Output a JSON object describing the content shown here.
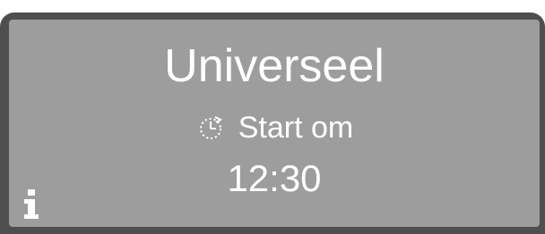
{
  "display": {
    "program_name": "Universeel",
    "delay_start_label": "Start om",
    "delay_start_time": "12:30",
    "icons": {
      "delay": "clock-icon",
      "info": "info-icon"
    },
    "colors": {
      "screen_background": "#9d9d9d",
      "bezel": "#4e4e4e",
      "text": "#ffffff"
    }
  }
}
